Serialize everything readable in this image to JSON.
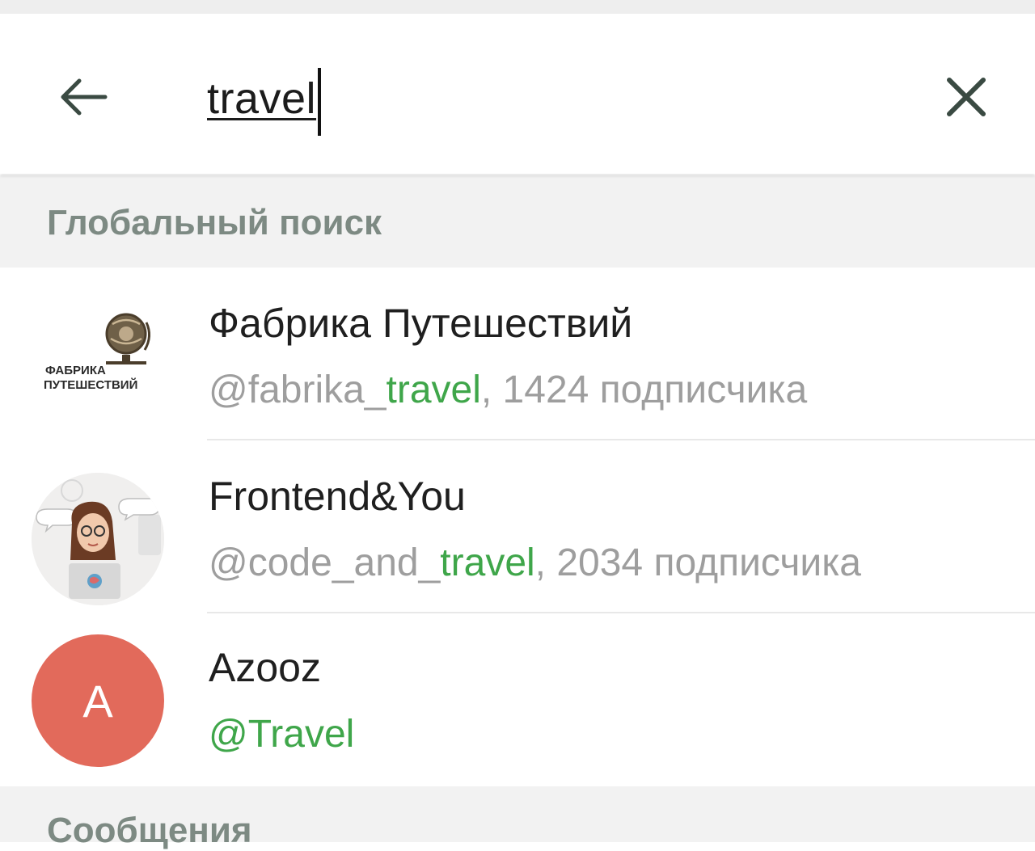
{
  "search": {
    "query": "travel",
    "back_icon": "arrow-left-icon",
    "clear_icon": "close-icon"
  },
  "sections": {
    "global": "Глобальный поиск",
    "messages": "Сообщения"
  },
  "results": [
    {
      "title": "Фабрика Путешествий",
      "handle_prefix": "@fabrika_",
      "handle_match": "travel",
      "handle_suffix": ", 1424 подписчика",
      "logo_line1": "ФАБРИКА",
      "logo_line2": "ПУТЕШЕСТВИЙ"
    },
    {
      "title": "Frontend&You",
      "handle_prefix": "@code_and_",
      "handle_match": "travel",
      "handle_suffix": ", 2034 подписчика"
    },
    {
      "title": "Azooz",
      "avatar_letter": "A",
      "handle_prefix": "",
      "handle_match": "@Travel",
      "handle_suffix": ""
    }
  ],
  "colors": {
    "accent_green": "#3fa64a",
    "avatar_red": "#e26a5b",
    "section_text": "#7d8a83",
    "muted_text": "#9e9e9e"
  }
}
